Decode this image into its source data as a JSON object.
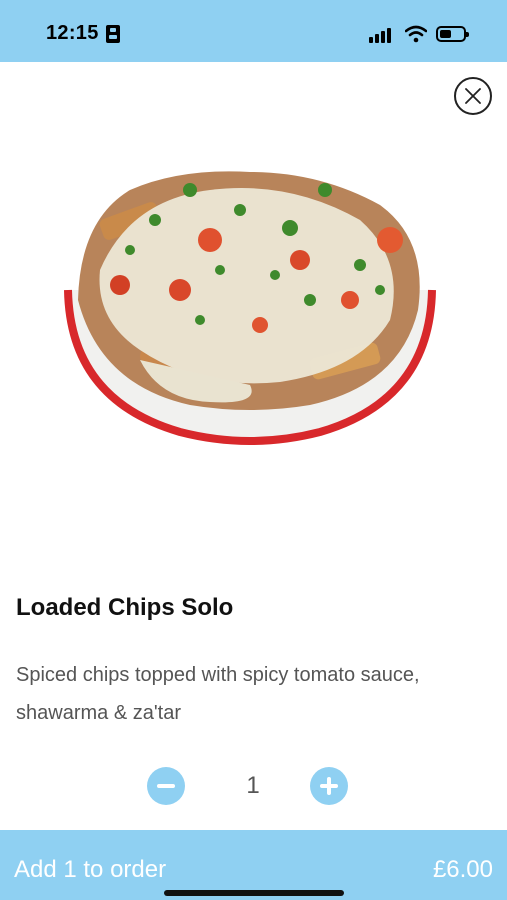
{
  "status_bar": {
    "time": "12:15",
    "battery_level": 0.4,
    "signal_bars": 4
  },
  "product": {
    "title": "Loaded Chips Solo",
    "description": "Spiced chips topped with spicy tomato sauce, shawarma & za'tar",
    "image_icon": "loaded-chips-bowl-image"
  },
  "quantity": {
    "value": "1",
    "minus_icon": "minus-circle-icon",
    "plus_icon": "plus-circle-icon"
  },
  "order": {
    "label": "Add 1 to order",
    "price": "£6.00"
  },
  "colors": {
    "accent": "#8fd0f2",
    "bowl_rim": "#d8282b"
  }
}
